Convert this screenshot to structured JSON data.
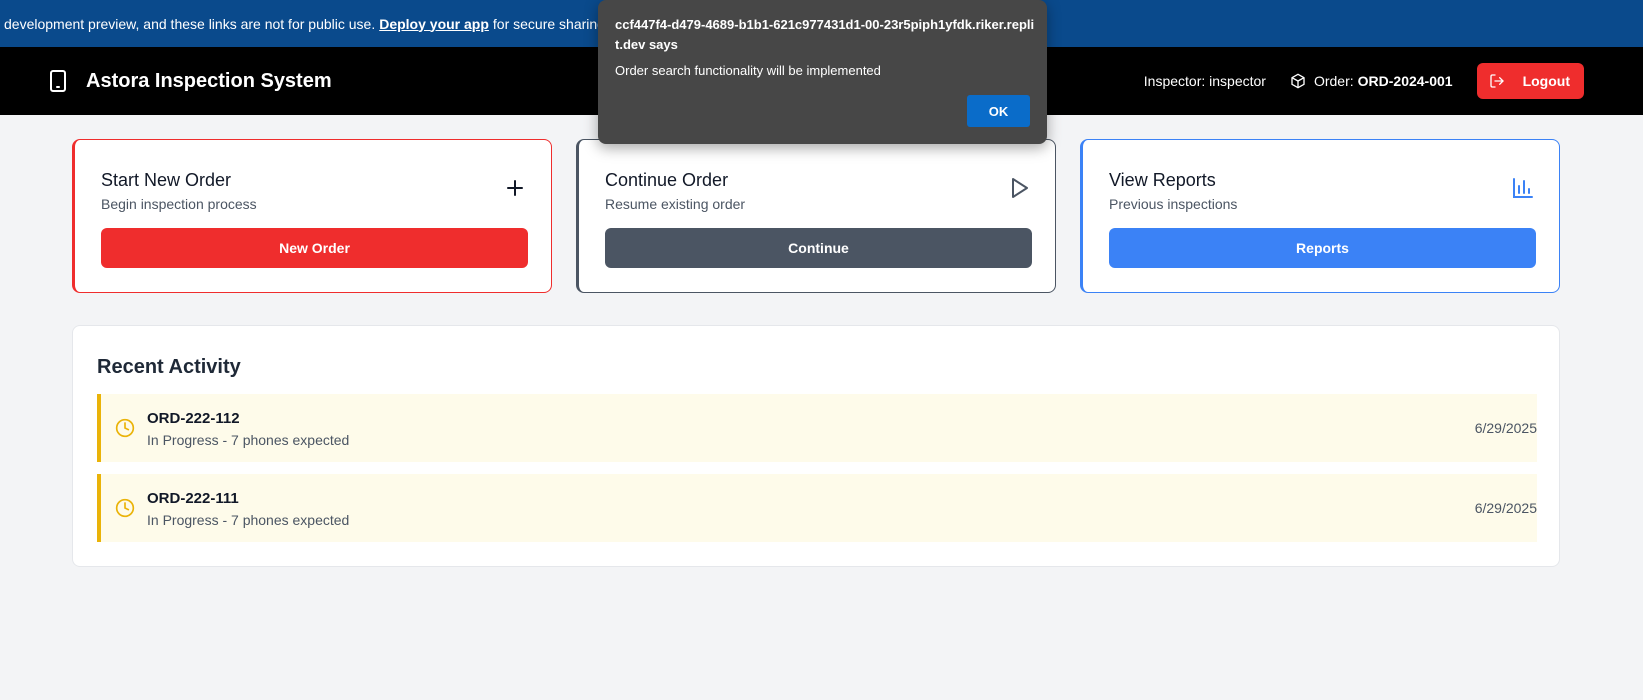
{
  "banner": {
    "text_before": "development preview, and these links are not for public use.",
    "link": "Deploy your app",
    "text_after": "for secure sharing"
  },
  "navbar": {
    "title": "Astora Inspection System",
    "inspector": "Inspector: inspector",
    "order_label": "Order:",
    "order_value": "ORD-2024-001",
    "logout": "Logout"
  },
  "cards": [
    {
      "title": "Start New Order",
      "subtitle": "Begin inspection process",
      "button": "New Order",
      "icon": "plus-icon",
      "color": "#ef2d2d"
    },
    {
      "title": "Continue Order",
      "subtitle": "Resume existing order",
      "button": "Continue",
      "icon": "play-icon",
      "color": "#4b5563"
    },
    {
      "title": "View Reports",
      "subtitle": "Previous inspections",
      "button": "Reports",
      "icon": "bar-chart-icon",
      "color": "#3b82f6"
    }
  ],
  "activity": {
    "title": "Recent Activity",
    "items": [
      {
        "id": "ORD-222-112",
        "status": "In Progress - 7 phones expected",
        "date": "6/29/2025"
      },
      {
        "id": "ORD-222-111",
        "status": "In Progress - 7 phones expected",
        "date": "6/29/2025"
      }
    ]
  },
  "dialog": {
    "title": "ccf447f4-d479-4689-b1b1-621c977431d1-00-23r5piph1yfdk.riker.replit.dev says",
    "message": "Order search functionality will be implemented",
    "ok": "OK"
  },
  "colors": {
    "banner": "#0a4a8c",
    "navbar": "#000000",
    "danger": "#ef2d2d",
    "neutral": "#4b5563",
    "primary": "#3b82f6",
    "warning": "#eab308",
    "activity_bg": "#fefbea"
  }
}
